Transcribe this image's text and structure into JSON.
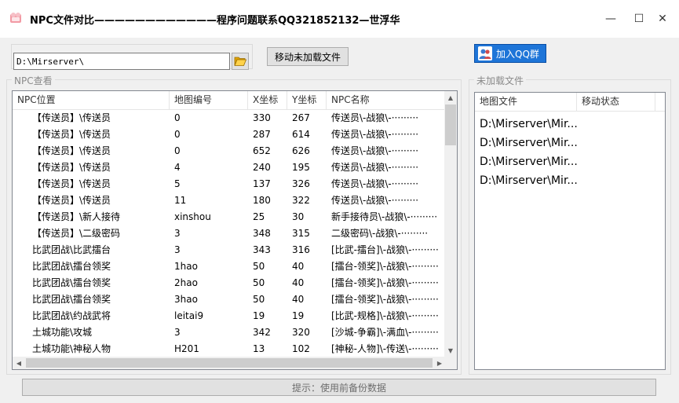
{
  "window": {
    "title": "NPC文件对比————————————程序问题联系QQ321852132—世浮华",
    "min_glyph": "—",
    "max_glyph": "☐",
    "close_glyph": "✕"
  },
  "toolbar": {
    "path_value": "D:\\Mirserver\\",
    "move_button_label": "移动未加载文件",
    "qq_button_label": "加入QQ群"
  },
  "npc_group": {
    "label": "NPC查看",
    "columns": [
      "NPC位置",
      "地图编号",
      "X坐标",
      "Y坐标",
      "NPC名称"
    ],
    "rows": [
      [
        "【传送员】\\传送员",
        "0",
        "330",
        "267",
        "传送员\\-战狼\\-·········"
      ],
      [
        "【传送员】\\传送员",
        "0",
        "287",
        "614",
        "传送员\\-战狼\\-·········"
      ],
      [
        "【传送员】\\传送员",
        "0",
        "652",
        "626",
        "传送员\\-战狼\\-·········"
      ],
      [
        "【传送员】\\传送员",
        "4",
        "240",
        "195",
        "传送员\\-战狼\\-·········"
      ],
      [
        "【传送员】\\传送员",
        "5",
        "137",
        "326",
        "传送员\\-战狼\\-·········"
      ],
      [
        "【传送员】\\传送员",
        "11",
        "180",
        "322",
        "传送员\\-战狼\\-·········"
      ],
      [
        "【传送员】\\新人接待",
        "xinshou",
        "25",
        "30",
        "新手接待员\\-战狼\\-·········"
      ],
      [
        "【传送员】\\二级密码",
        "3",
        "348",
        "315",
        "二级密码\\-战狼\\-·········"
      ],
      [
        "比武团战\\比武擂台",
        "3",
        "343",
        "316",
        "[比武-擂台]\\-战狼\\-·········"
      ],
      [
        "比武团战\\擂台领奖",
        "1hao",
        "50",
        "40",
        "[擂台-领奖]\\-战狼\\-·········"
      ],
      [
        "比武团战\\擂台领奖",
        "2hao",
        "50",
        "40",
        "[擂台-领奖]\\-战狼\\-·········"
      ],
      [
        "比武团战\\擂台领奖",
        "3hao",
        "50",
        "40",
        "[擂台-领奖]\\-战狼\\-·········"
      ],
      [
        "比武团战\\约战武将",
        "leitai9",
        "19",
        "19",
        "[比武-规格]\\-战狼\\-·········"
      ],
      [
        "土城功能\\攻城",
        "3",
        "342",
        "320",
        "[沙城-争霸]\\-满血\\-·········"
      ],
      [
        "土城功能\\神秘人物",
        "H201",
        "13",
        "102",
        "[神秘-人物]\\-传送\\-·········"
      ]
    ]
  },
  "unloaded_group": {
    "label": "未加载文件",
    "columns": [
      "地图文件",
      "移动状态"
    ],
    "rows": [
      "D:\\Mirserver\\Mir...",
      "D:\\Mirserver\\Mir...",
      "D:\\Mirserver\\Mir...",
      "D:\\Mirserver\\Mir..."
    ]
  },
  "status": {
    "text": "提示：使用前备份数据"
  },
  "colors": {
    "accent_button": "#1e75d8",
    "window_bg": "#f0f0f0"
  }
}
